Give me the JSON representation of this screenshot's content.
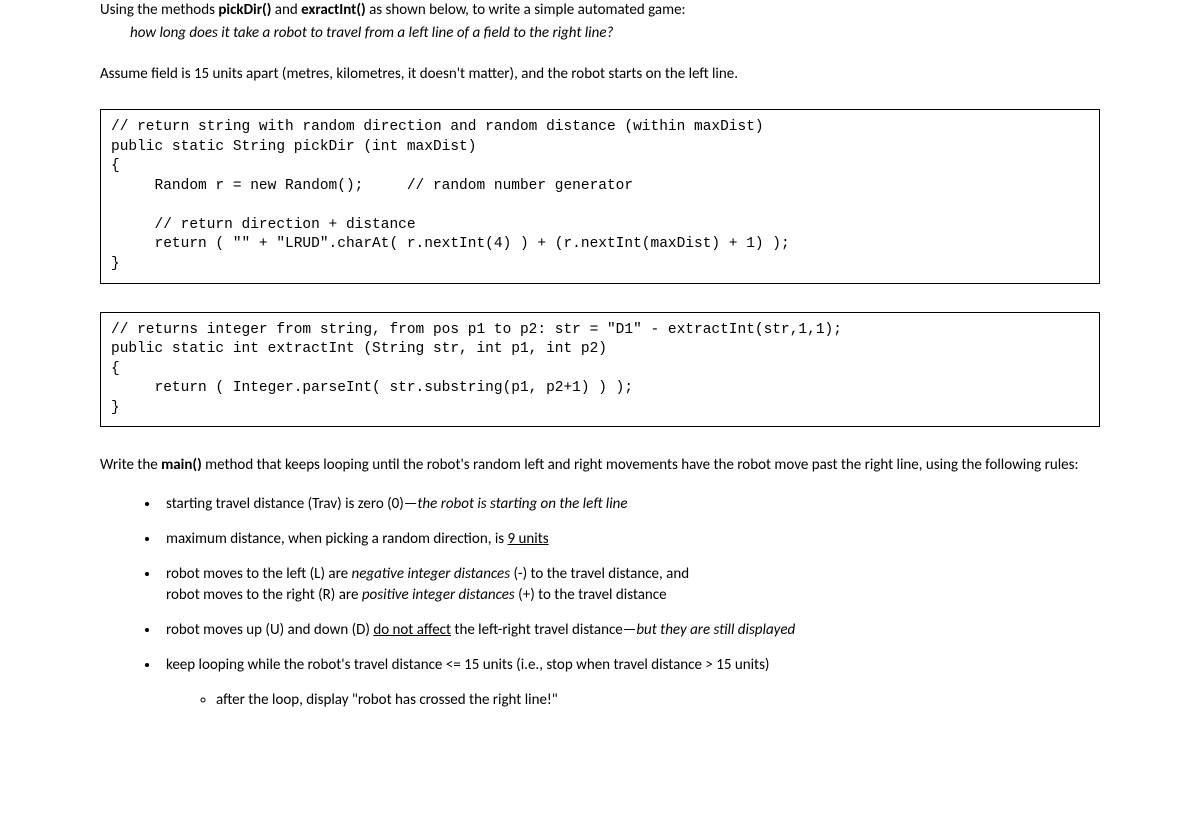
{
  "intro": {
    "prefix": "Using the methods ",
    "m1": "pickDir()",
    "mid": " and ",
    "m2": "exractInt()",
    "suffix": " as shown below, to write a simple automated game:"
  },
  "question": "how long does it take a robot to travel from a left line of a field to the right line?",
  "assume": "Assume field is 15 units apart (metres, kilometres, it doesn't matter), and the robot starts on the left line.",
  "code1": "// return string with random direction and random distance (within maxDist)\npublic static String pickDir (int maxDist)\n{\n     Random r = new Random();     // random number generator\n\n     // return direction + distance\n     return ( \"\" + \"LRUD\".charAt( r.nextInt(4) ) + (r.nextInt(maxDist) + 1) );\n}",
  "code2": "// returns integer from string, from pos p1 to p2: str = \"D1\" - extractInt(str,1,1);\npublic static int extractInt (String str, int p1, int p2)\n{\n     return ( Integer.parseInt( str.substring(p1, p2+1) ) );\n}",
  "task": {
    "prefix": "Write the ",
    "bold": "main()",
    "suffix": " method that keeps looping until the robot's random left and right movements have the robot move past the right line, using the following rules:"
  },
  "rules": {
    "r1a": "starting travel distance (Trav) is zero (0)—",
    "r1b": "the robot is starting on the left line",
    "r2a": "maximum distance, when picking a random direction, is ",
    "r2b": "9 units",
    "r3a": "robot moves to the left (L) are ",
    "r3b": "negative integer distances",
    "r3c": " (-) to the travel distance, and",
    "r3d": "robot moves to the right (R) are ",
    "r3e": "positive integer distances",
    "r3f": " (+) to the travel distance",
    "r4a": "robot moves up (U) and down (D) ",
    "r4b": "do not affect",
    "r4c": " the left-right travel distance—",
    "r4d": "but they are still displayed",
    "r5": "keep looping while the robot's travel distance <= 15 units (i.e., stop when travel distance > 15 units)",
    "r5sub": "after the loop, display \"robot has crossed the right line!\""
  }
}
